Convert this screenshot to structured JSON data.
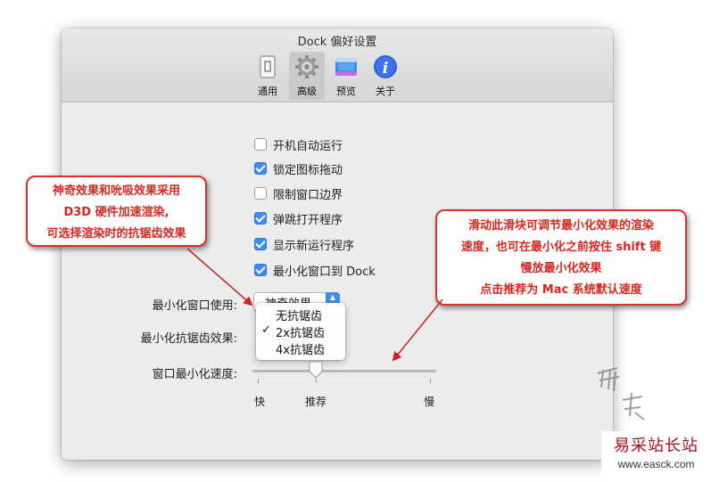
{
  "window": {
    "title": "Dock 偏好设置"
  },
  "toolbar": [
    {
      "label": "通用",
      "icon": "general-icon"
    },
    {
      "label": "高级",
      "icon": "gear-icon",
      "selected": true
    },
    {
      "label": "预览",
      "icon": "preview-icon"
    },
    {
      "label": "关于",
      "icon": "info-icon"
    }
  ],
  "checkboxes": [
    {
      "label": "开机自动运行",
      "checked": false
    },
    {
      "label": "锁定图标拖动",
      "checked": true
    },
    {
      "label": "限制窗口边界",
      "checked": false
    },
    {
      "label": "弹跳打开程序",
      "checked": true
    },
    {
      "label": "显示新运行程序",
      "checked": true
    },
    {
      "label": "最小化窗口到 Dock",
      "checked": true
    }
  ],
  "minimize_effect": {
    "label": "最小化窗口使用:",
    "value": "神奇效果"
  },
  "antialias": {
    "label": "最小化抗锯齿效果:",
    "checkmark": "✓",
    "options": [
      {
        "label": "无抗锯齿",
        "selected": false
      },
      {
        "label": "2x抗锯齿",
        "selected": true
      },
      {
        "label": "4x抗锯齿",
        "selected": false
      }
    ]
  },
  "speed": {
    "label": "窗口最小化速度:",
    "fast": "快",
    "recommended": "推荐",
    "slow": "慢",
    "value_fraction": 0.33
  },
  "callouts": {
    "left": [
      "神奇效果和吮吸效果采用",
      "D3D 硬件加速渲染,",
      "可选择渲染时的抗锯齿效果"
    ],
    "right": [
      "滑动此滑块可调节最小化效果的渲染",
      "速度，也可在最小化之前按住 shift 键",
      "慢放最小化效果",
      "点击推荐为 Mac 系统默认速度"
    ]
  },
  "watermark": {
    "brand": "易采站长站",
    "url": "www.easck.com"
  },
  "colors": {
    "accent": "#3f8cf0",
    "callout_red": "#d7261e"
  }
}
